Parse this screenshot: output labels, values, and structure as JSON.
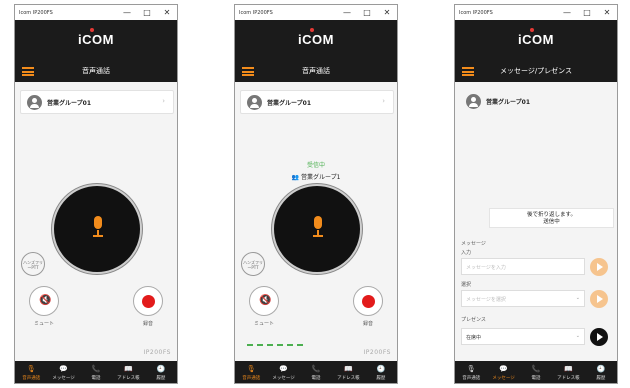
{
  "windows": [
    {
      "title": "Icom IP200FS",
      "controls": {
        "minimize": "—",
        "maximize": "□",
        "close": "✕"
      },
      "logo": "iCOM",
      "header_title": "音声通話",
      "group_name": "営業グループ01",
      "handsfree_label": "ハンズフリーPTT",
      "mute_label": "ミュート",
      "record_label": "録音",
      "model": "IP200FS"
    },
    {
      "title": "Icom IP200FS",
      "controls": {
        "minimize": "—",
        "maximize": "□",
        "close": "✕"
      },
      "logo": "iCOM",
      "header_title": "音声通話",
      "group_name": "営業グループ01",
      "status_text": "受信中",
      "caller_text": "営業グループ1",
      "handsfree_label": "ハンズフリーPTT",
      "mute_label": "ミュート",
      "record_label": "録音",
      "model": "IP200FS"
    },
    {
      "title": "Icom IP200FS",
      "controls": {
        "minimize": "—",
        "maximize": "□",
        "close": "✕"
      },
      "logo": "iCOM",
      "header_title": "メッセージ/プレゼンス",
      "group_name": "営業グループ01",
      "notice_line1": "後で折り返します。",
      "notice_line2": "送信中",
      "message_section": "メッセージ",
      "input_label": "入力",
      "input_placeholder": "メッセージを入力",
      "select_label": "選択",
      "select_placeholder": "メッセージを選択",
      "presence_label": "プレゼンス",
      "presence_value": "在席中"
    }
  ],
  "nav": [
    {
      "icon": "🎙",
      "label": "音声通話"
    },
    {
      "icon": "💬",
      "label": "メッセージ"
    },
    {
      "icon": "📞",
      "label": "電話"
    },
    {
      "icon": "📖",
      "label": "アドレス帳"
    },
    {
      "icon": "🕘",
      "label": "履歴"
    }
  ],
  "colors": {
    "accent": "#f28c1c",
    "record": "#e21b1b",
    "dark": "#1b1b1b",
    "receiving": "#4caf50"
  }
}
